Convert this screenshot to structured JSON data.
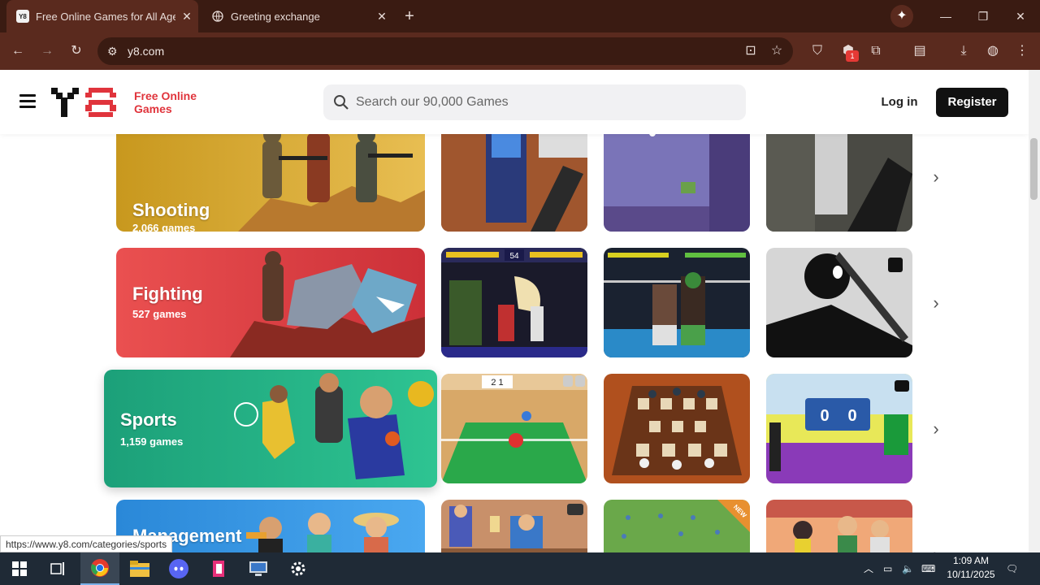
{
  "browser": {
    "tabs": [
      {
        "title": "Free Online Games for All Ages",
        "favicon_text": "Y8",
        "active": true
      },
      {
        "title": "Greeting exchange",
        "active": false
      }
    ],
    "url": "y8.com",
    "extension_badge": "1"
  },
  "site": {
    "logo_text": "Free Online Games",
    "search_placeholder": "Search our 90,000 Games",
    "login_label": "Log in",
    "register_label": "Register"
  },
  "categories": [
    {
      "name": "Shooting",
      "count": "2,066 games",
      "color_from": "#c89a22",
      "color_to": "#e6b84a"
    },
    {
      "name": "Fighting",
      "count": "527 games",
      "color_from": "#e8484a",
      "color_to": "#d2323a"
    },
    {
      "name": "Sports",
      "count": "1,159 games",
      "color_from": "#1fa37a",
      "color_to": "#2cc291"
    },
    {
      "name": "Management",
      "count": "",
      "color_from": "#2a88d8",
      "color_to": "#49a6f0"
    }
  ],
  "thumbs": {
    "sports_row": {
      "flag_score": "2 1",
      "score_left": "0",
      "score_right": "0",
      "new_label": "NEW",
      "menu_label": "menu"
    },
    "fighting_row": {
      "timer": "54"
    }
  },
  "status_bar_url": "https://www.y8.com/categories/sports",
  "taskbar": {
    "time": "1:09 AM",
    "date": "10/11/2025"
  }
}
